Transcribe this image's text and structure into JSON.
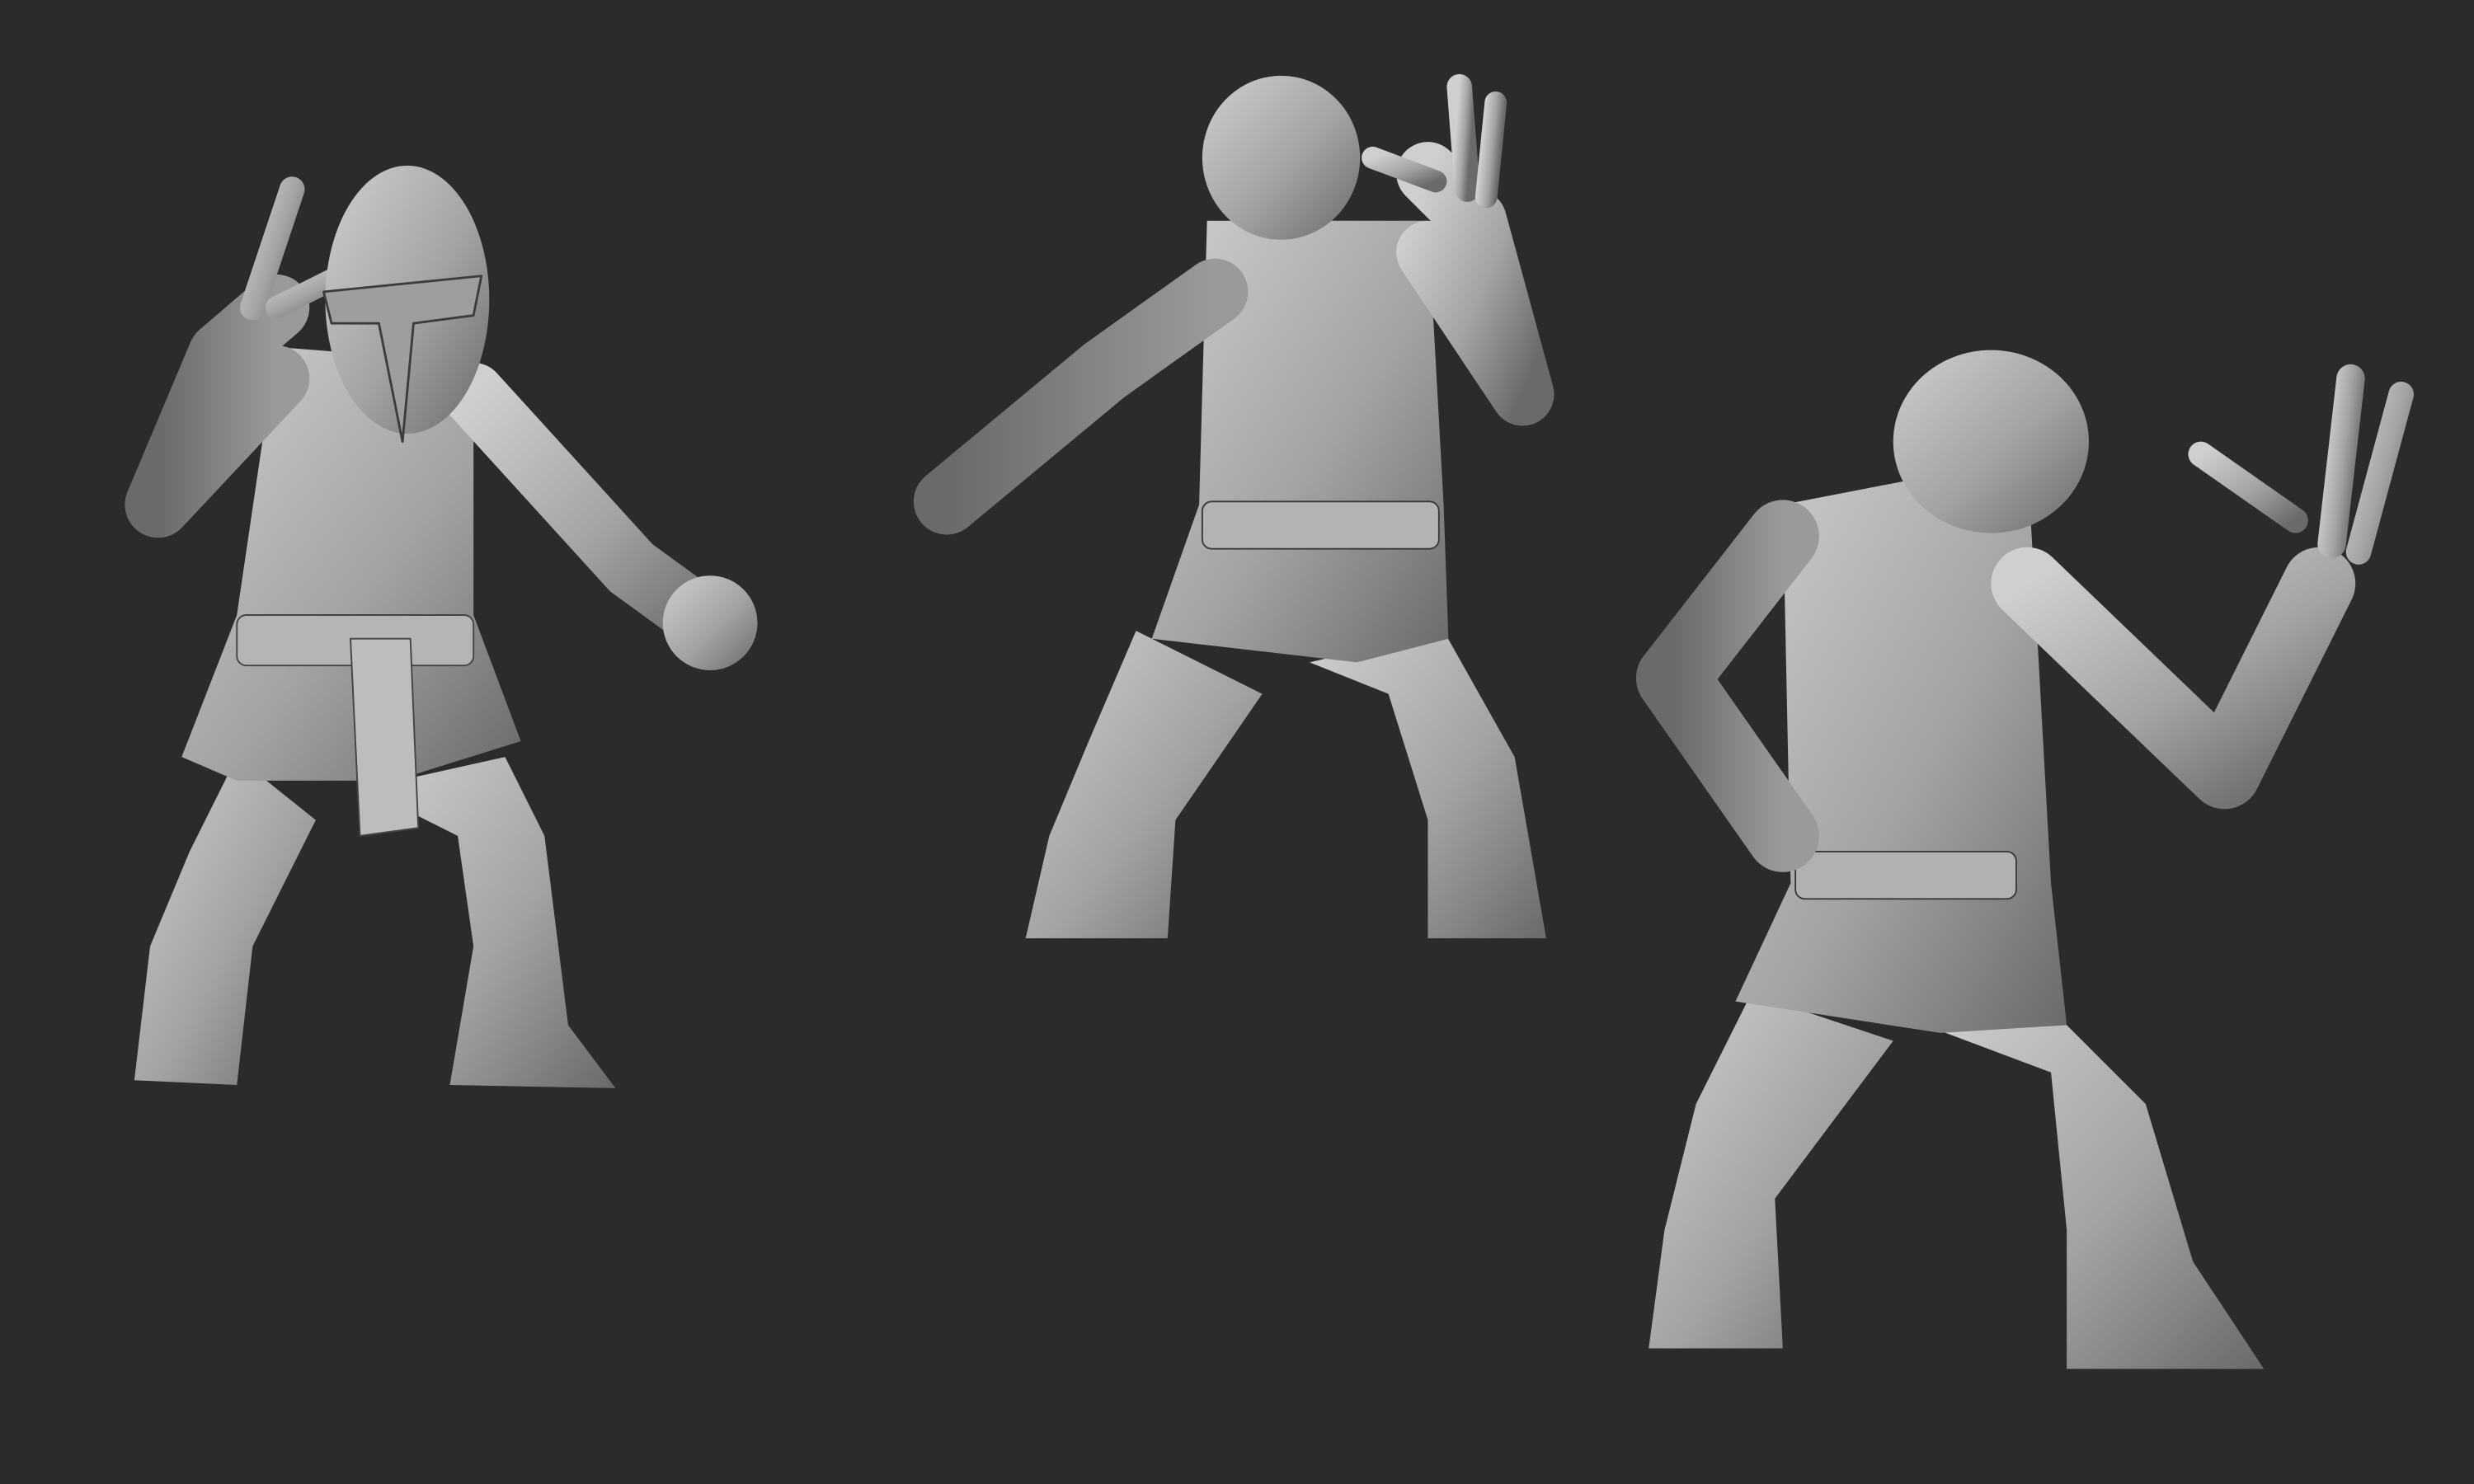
{
  "scene": {
    "background_color": "#2b2b2b",
    "material_light": "#c9c9c9",
    "material_mid": "#9a9a9a",
    "material_dark": "#5e5e5e",
    "figures": [
      {
        "view": "front"
      },
      {
        "view": "back"
      },
      {
        "view": "back-three-quarter"
      }
    ]
  }
}
